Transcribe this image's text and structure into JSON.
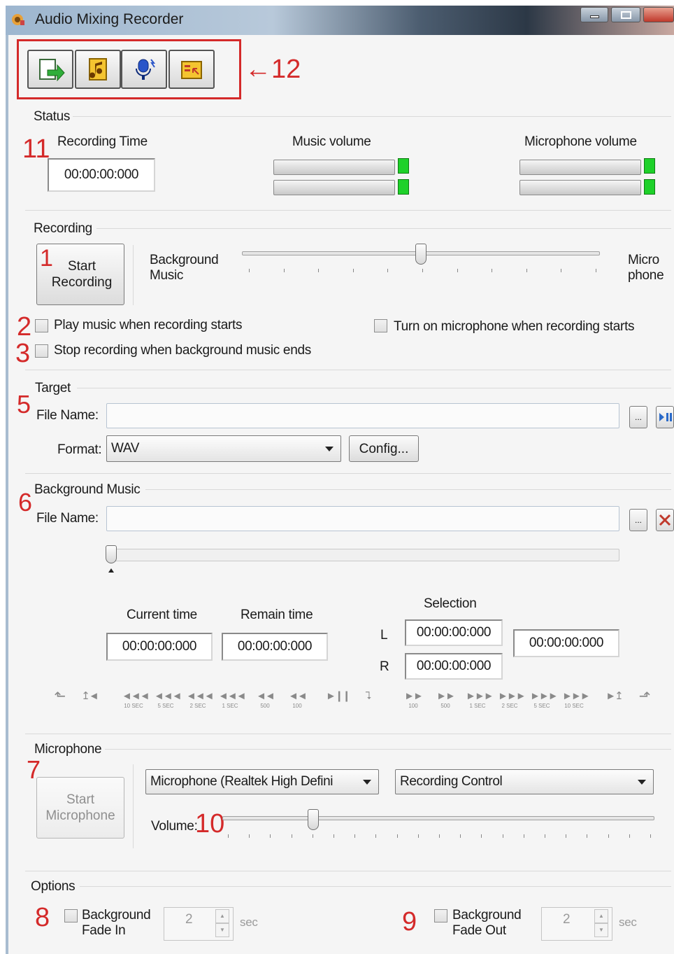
{
  "window": {
    "title": "Audio Mixing Recorder"
  },
  "annotations": {
    "a1": "1",
    "a2": "2",
    "a3": "3",
    "a5": "5",
    "a6": "6",
    "a7": "7",
    "a8": "8",
    "a9": "9",
    "a10": "10",
    "a11": "11",
    "a12": "←12"
  },
  "status": {
    "group": "Status",
    "recording_time_label": "Recording Time",
    "recording_time": "00:00:00:000",
    "music_volume_label": "Music volume",
    "mic_volume_label": "Microphone volume"
  },
  "recording": {
    "group": "Recording",
    "start_button": "Start Recording",
    "background_music": "Background Music",
    "micro_phone": "Micro phone",
    "play_music": "Play music when recording starts",
    "stop_recording": "Stop recording when background music ends",
    "turn_on_mic": "Turn on microphone when recording starts"
  },
  "target": {
    "group": "Target",
    "file_name_label": "File Name:",
    "file_name": "",
    "browse": "...",
    "format_label": "Format:",
    "format_value": "WAV",
    "config_button": "Config..."
  },
  "bgmusic": {
    "group": "Background Music",
    "file_name_label": "File Name:",
    "file_name": "",
    "browse": "...",
    "current_time_label": "Current time",
    "remain_time_label": "Remain time",
    "selection_label": "Selection",
    "current_time": "00:00:00:000",
    "remain_time": "00:00:00:000",
    "l_label": "L",
    "r_label": "R",
    "sel_l": "00:00:00:000",
    "sel_r": "00:00:00:000",
    "sel_len": "00:00:00:000",
    "transport": [
      {
        "g": "◄◄◄",
        "s": "10 SEC"
      },
      {
        "g": "◄◄◄",
        "s": "5 SEC"
      },
      {
        "g": "◄◄◄",
        "s": "2 SEC"
      },
      {
        "g": "◄◄◄",
        "s": "1 SEC"
      },
      {
        "g": "◄◄",
        "s": "500"
      },
      {
        "g": "◄◄",
        "s": "100"
      },
      {
        "g": "►►",
        "s": "100"
      },
      {
        "g": "►►",
        "s": "500"
      },
      {
        "g": "►►►",
        "s": "1 SEC"
      },
      {
        "g": "►►►",
        "s": "2 SEC"
      },
      {
        "g": "►►►",
        "s": "5 SEC"
      },
      {
        "g": "►►►",
        "s": "10 SEC"
      }
    ]
  },
  "microphone": {
    "group": "Microphone",
    "start_button": "Start Microphone",
    "device": "Microphone (Realtek High Defini",
    "control": "Recording Control",
    "volume_label": "Volume:"
  },
  "options": {
    "group": "Options",
    "fade_in_label": "Background Fade In",
    "fade_in_value": "2",
    "fade_out_label": "Background Fade Out",
    "fade_out_value": "2",
    "unit": "sec"
  },
  "colors": {
    "annotation": "#d42a2a",
    "led": "#1ed12a"
  }
}
